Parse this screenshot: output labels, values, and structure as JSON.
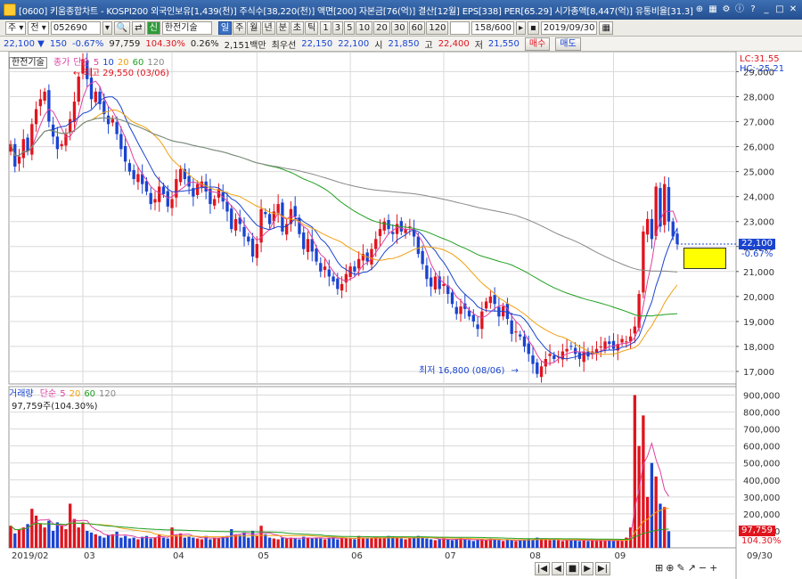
{
  "window": {
    "title": "[0600] 키움종합차트 - KOSPI200 외국인보유[1,439(천)] 주식수[38,220(천)] 액면[200] 자본금[76(억)] 결산[12월] EPS[338] PER[65.29] 시가총액[8,447(억)] 유통비율[31.3]"
  },
  "toolbar": {
    "mode_label": "주",
    "order_label": "전",
    "code": "052690",
    "stock_name": "한전기술",
    "period_buttons": [
      "일",
      "주",
      "월",
      "년",
      "분",
      "초",
      "틱"
    ],
    "minute_buttons": [
      "1",
      "3",
      "5",
      "10",
      "20",
      "30",
      "60",
      "120"
    ],
    "count_label": "158/600",
    "date_value": "2019/09/30"
  },
  "quote": {
    "price": "22,100",
    "change": "150",
    "change_pct": "-0.67%",
    "volume": "97,759",
    "volume_ratio": "104.30%",
    "turnover": "0.26%",
    "trade_value": "2,151백만",
    "best_ask_label": "최우선",
    "best_ask": "22,150",
    "best_bid": "22,100",
    "open_label": "시",
    "open": "21,850",
    "high_label": "고",
    "high": "22,400",
    "low_label": "저",
    "low": "21,550",
    "buy_label": "매수",
    "sell_label": "매도"
  },
  "price_panel": {
    "legend_name": "한전기술",
    "legend_items": [
      "종가",
      "단순",
      "5",
      "10",
      "20",
      "60",
      "120"
    ],
    "high_annotation": "최고 29,550 (03/06)",
    "low_annotation": "최저 16,800 (08/06)",
    "lc_label": "LC:31.55",
    "hc_label": "HC:-25.21",
    "current_price_label": "22,100",
    "current_change_label": "-0.67%"
  },
  "volume_panel": {
    "legend_name": "거래량",
    "legend_items": [
      "단순",
      "5",
      "20",
      "60",
      "120"
    ],
    "current_label": "97,759주(104.30%)",
    "right_value_label": "97,759",
    "right_pct_label": "104.30%"
  },
  "date_axis": {
    "labels": [
      "2019/02",
      "03",
      "04",
      "05",
      "06",
      "07",
      "08",
      "09"
    ],
    "right_label": "09/30"
  },
  "colors": {
    "up": "#e0141e",
    "down": "#1a44d0",
    "ma5": "#e040a0",
    "ma10": "#1a44d0",
    "ma20": "#f0a010",
    "ma60": "#20a020",
    "ma120": "#888888"
  },
  "chart_data": {
    "type": "candlestick",
    "y_axis": {
      "min": 17000,
      "max": 29000,
      "step": 1000,
      "ticks": [
        "29,000",
        "28,000",
        "27,000",
        "26,000",
        "25,000",
        "24,000",
        "23,000",
        "22,000",
        "21,000",
        "20,000",
        "19,000",
        "18,000",
        "17,000"
      ]
    },
    "volume_axis": {
      "min": 0,
      "max": 900000,
      "ticks": [
        "900,000",
        "800,000",
        "700,000",
        "600,000",
        "500,000",
        "400,000",
        "300,000",
        "200,000",
        "100,000"
      ]
    },
    "close_series": [
      26100,
      25200,
      25600,
      26300,
      25800,
      26900,
      27500,
      27900,
      28200,
      27000,
      26400,
      25900,
      26100,
      26500,
      27100,
      27800,
      28800,
      29500,
      28700,
      27900,
      28200,
      27700,
      27300,
      26900,
      27100,
      26500,
      25900,
      25400,
      25000,
      24700,
      24900,
      24500,
      24200,
      23700,
      23900,
      24400,
      24100,
      23600,
      23900,
      24700,
      25100,
      24700,
      24400,
      24000,
      24500,
      24600,
      24200,
      23700,
      23900,
      24300,
      23800,
      23400,
      22700,
      23100,
      22900,
      22400,
      22200,
      21600,
      22100,
      23500,
      23300,
      22900,
      23400,
      23700,
      22600,
      22900,
      23500,
      23200,
      22500,
      21900,
      22300,
      21800,
      21400,
      21000,
      21200,
      20800,
      20600,
      20300,
      20500,
      20900,
      21200,
      21000,
      21500,
      21700,
      21400,
      21900,
      22300,
      22700,
      23000,
      22700,
      22500,
      22900,
      22600,
      22700,
      22800,
      22400,
      21700,
      21300,
      20700,
      20400,
      20800,
      20300,
      20500,
      20100,
      19700,
      19300,
      19600,
      19500,
      19200,
      19000,
      18700,
      19400,
      19800,
      20000,
      19700,
      19200,
      19600,
      19100,
      18500,
      18600,
      18400,
      18000,
      17700,
      17300,
      16900,
      17200,
      17500,
      17700,
      17500,
      17600,
      17800,
      17900,
      18000,
      17700,
      17500,
      17800,
      17600,
      17800,
      17900,
      18000,
      18200,
      18100,
      17900,
      18100,
      18300,
      18200,
      18400,
      18800,
      20100,
      22600,
      23100,
      22300,
      24400,
      22800,
      24500,
      23000,
      22400,
      22100
    ],
    "volume_series": [
      130000,
      85000,
      110000,
      120000,
      140000,
      230000,
      190000,
      140000,
      120000,
      160000,
      100000,
      150000,
      130000,
      110000,
      260000,
      170000,
      120000,
      150000,
      100000,
      90000,
      80000,
      70000,
      60000,
      75000,
      80000,
      95000,
      60000,
      70000,
      55000,
      60000,
      50000,
      65000,
      70000,
      55000,
      60000,
      80000,
      60000,
      55000,
      120000,
      75000,
      85000,
      60000,
      65000,
      60000,
      55000,
      50000,
      70000,
      50000,
      60000,
      55000,
      65000,
      70000,
      110000,
      80000,
      75000,
      90000,
      60000,
      100000,
      70000,
      130000,
      80000,
      60000,
      55000,
      50000,
      60000,
      55000,
      60000,
      55000,
      50000,
      65000,
      60000,
      55000,
      60000,
      55000,
      50000,
      60000,
      65000,
      50000,
      55000,
      60000,
      55000,
      50000,
      70000,
      60000,
      55000,
      60000,
      65000,
      55000,
      60000,
      70000,
      65000,
      60000,
      55000,
      50000,
      60000,
      65000,
      70000,
      60000,
      55000,
      50000,
      45000,
      50000,
      55000,
      50000,
      45000,
      50000,
      55000,
      50000,
      45000,
      40000,
      45000,
      50000,
      45000,
      55000,
      50000,
      45000,
      40000,
      50000,
      45000,
      40000,
      45000,
      50000,
      55000,
      50000,
      60000,
      55000,
      50000,
      45000,
      50000,
      45000,
      40000,
      45000,
      50000,
      45000,
      40000,
      45000,
      40000,
      45000,
      40000,
      45000,
      40000,
      45000,
      40000,
      45000,
      40000,
      60000,
      120000,
      900000,
      600000,
      780000,
      300000,
      500000,
      420000,
      260000,
      240000,
      97759
    ]
  }
}
